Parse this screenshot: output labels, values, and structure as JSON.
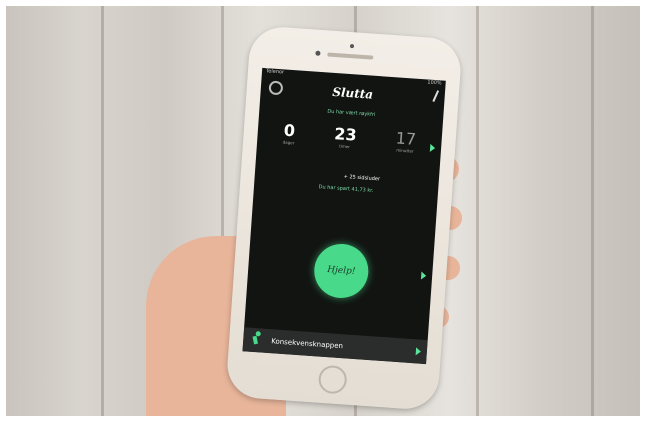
{
  "app": {
    "title": "Slutta",
    "banner": "Du har vært røykfri",
    "status_left": "Telenor",
    "status_right": "100%"
  },
  "stats": [
    {
      "value": "0",
      "label": "dager"
    },
    {
      "value": "23",
      "label": "timer"
    },
    {
      "value": "17",
      "label": "minutter"
    }
  ],
  "cigarettes_line": "+ 25 sidsluder",
  "saved_line": "Du har spart 41,73 kr.",
  "help_button": "Hjelp!",
  "bottom_bar": {
    "label": "Konsekvensknappen"
  },
  "colors": {
    "accent": "#48d98a",
    "screen_bg": "#121412"
  }
}
